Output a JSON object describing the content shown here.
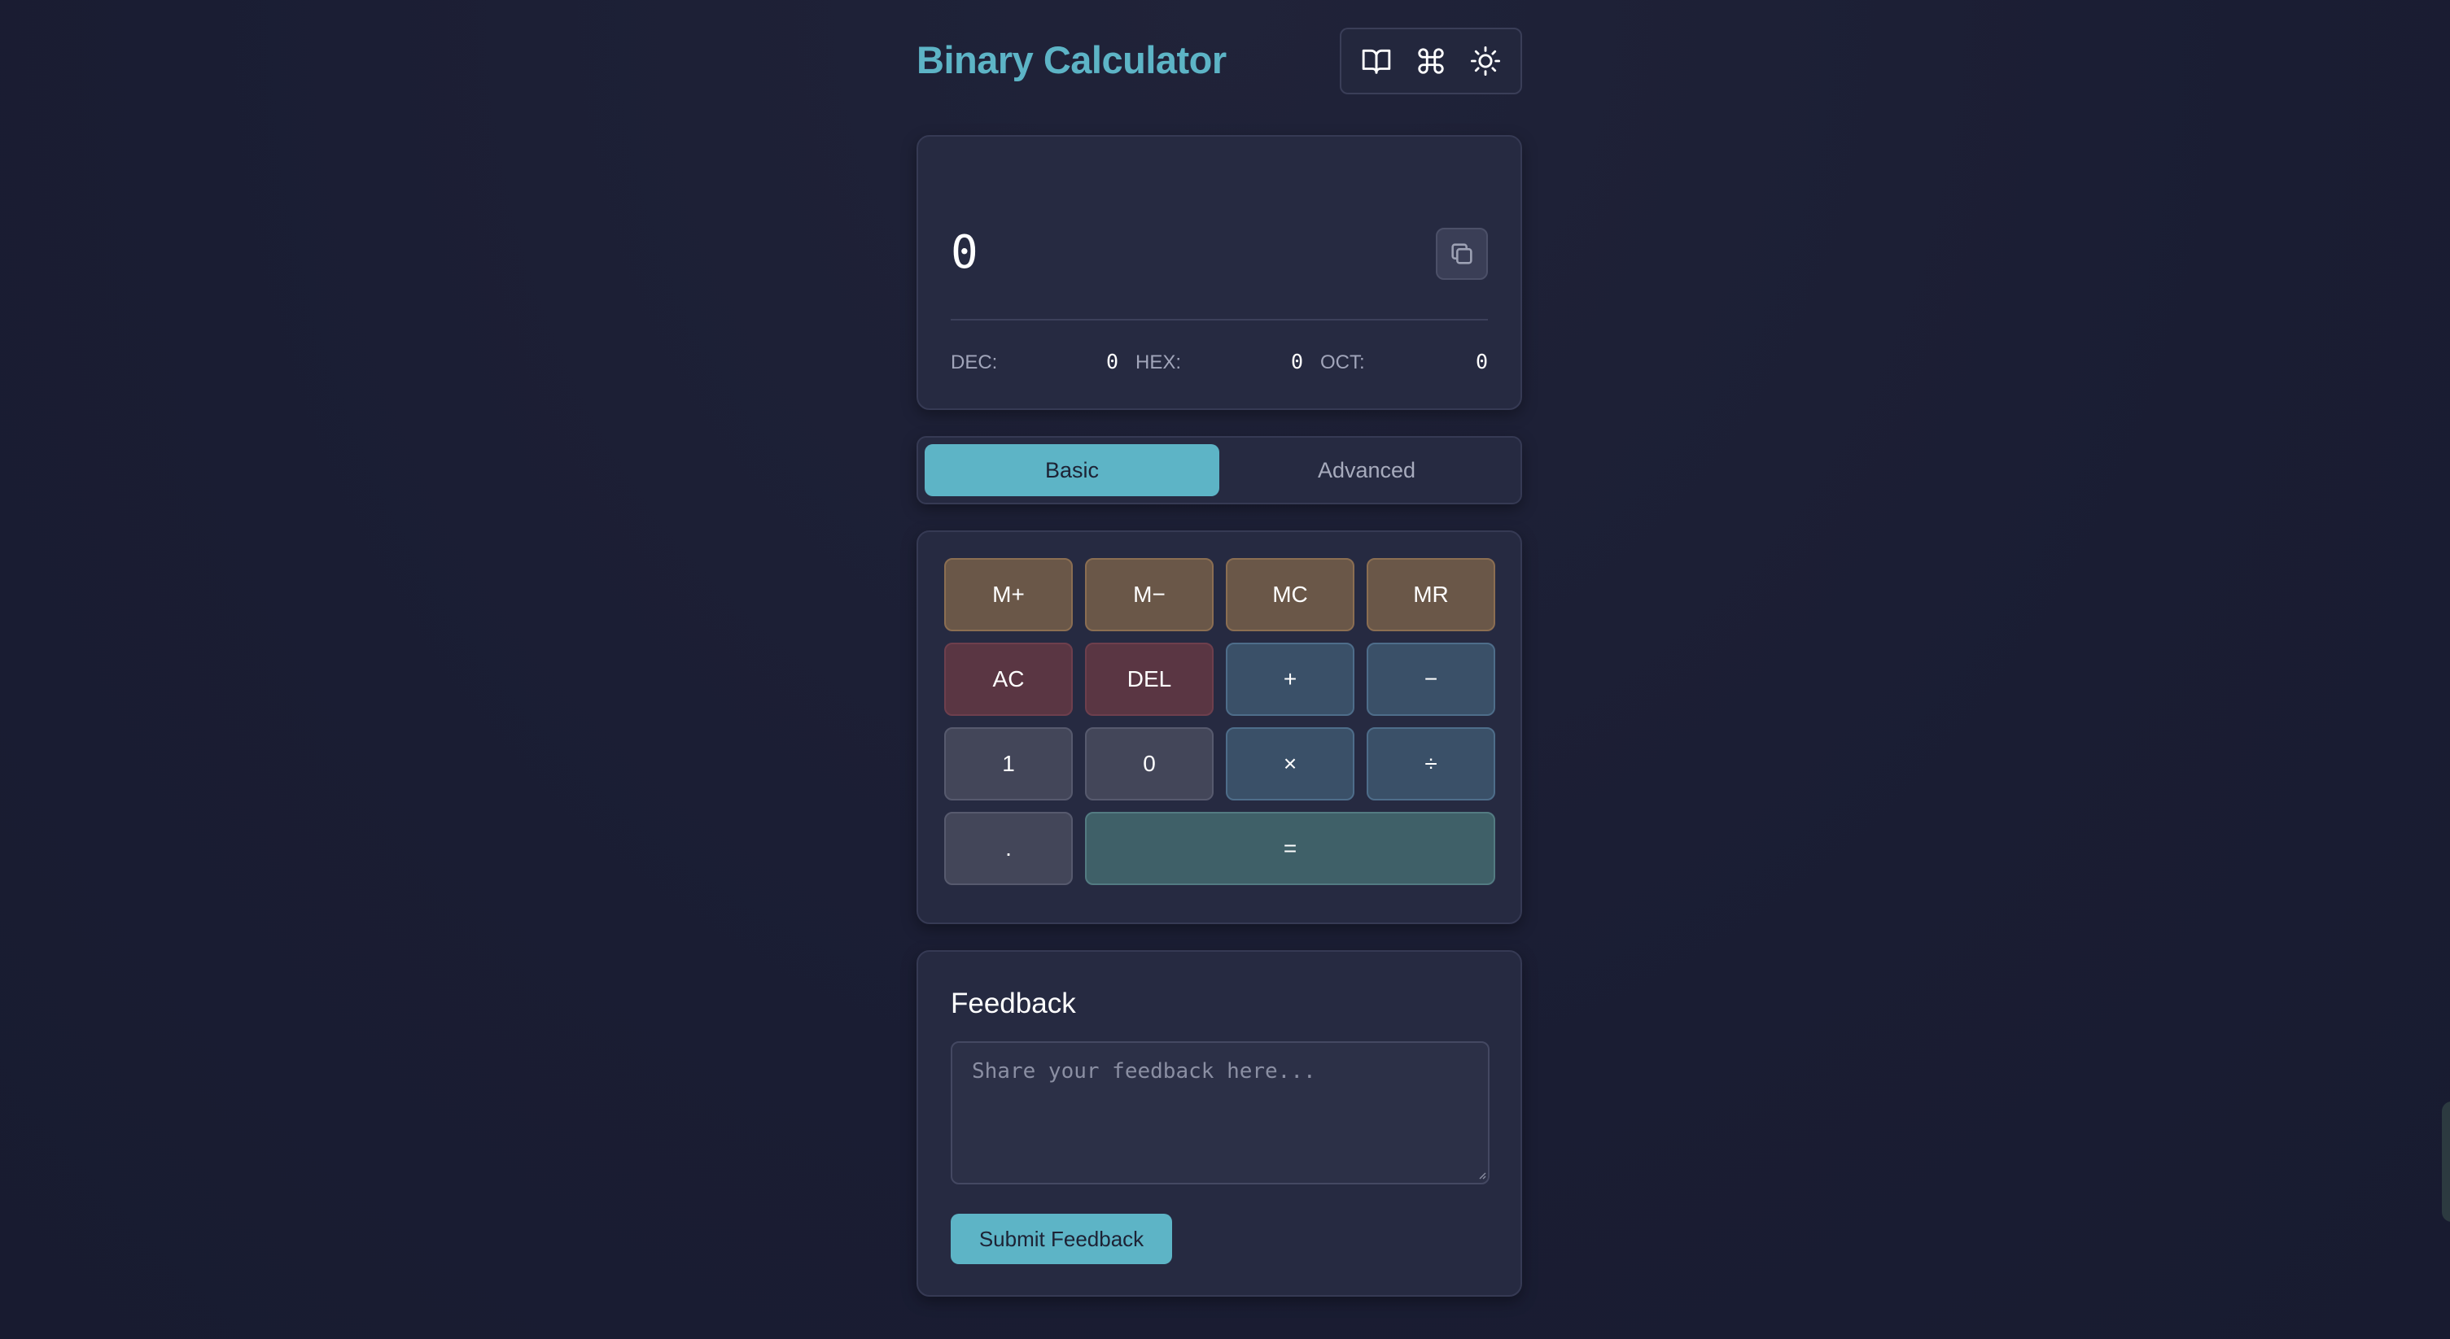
{
  "header": {
    "title": "Binary Calculator",
    "tools": [
      {
        "icon": "book-open-icon",
        "label": "Documentation"
      },
      {
        "icon": "command-icon",
        "label": "Keyboard shortcuts"
      },
      {
        "icon": "sun-icon",
        "label": "Toggle theme"
      }
    ]
  },
  "display": {
    "value": "0",
    "copy_icon": "copy-icon",
    "conversions": [
      {
        "label": "DEC:",
        "value": "0"
      },
      {
        "label": "HEX:",
        "value": "0"
      },
      {
        "label": "OCT:",
        "value": "0"
      }
    ]
  },
  "tabs": [
    {
      "label": "Basic",
      "active": true
    },
    {
      "label": "Advanced",
      "active": false
    }
  ],
  "keypad": {
    "keys": [
      {
        "label": "M+",
        "kind": "mem"
      },
      {
        "label": "M−",
        "kind": "mem"
      },
      {
        "label": "MC",
        "kind": "mem"
      },
      {
        "label": "MR",
        "kind": "mem"
      },
      {
        "label": "AC",
        "kind": "clear"
      },
      {
        "label": "DEL",
        "kind": "clear"
      },
      {
        "label": "+",
        "kind": "op"
      },
      {
        "label": "−",
        "kind": "op"
      },
      {
        "label": "1",
        "kind": "num"
      },
      {
        "label": "0",
        "kind": "num"
      },
      {
        "label": "×",
        "kind": "op"
      },
      {
        "label": "÷",
        "kind": "op"
      },
      {
        "label": ".",
        "kind": "num"
      },
      {
        "label": "=",
        "kind": "eq"
      }
    ]
  },
  "feedback": {
    "title": "Feedback",
    "placeholder": "Share your feedback here...",
    "value": "",
    "submit_label": "Submit Feedback"
  },
  "colors": {
    "accent": "#5db4c6",
    "background": "#1c1f36",
    "card": "#262a41",
    "memory_key": "#6a5748",
    "clear_key": "#5a3643",
    "operator_key": "#3a5068",
    "number_key": "#434659",
    "equals_key": "#3f6068"
  }
}
